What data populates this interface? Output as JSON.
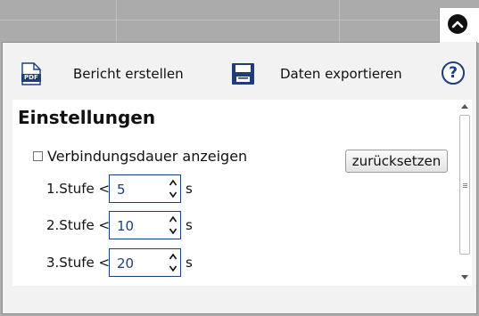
{
  "toolbar": {
    "report_label": "Bericht erstellen",
    "export_label": "Daten exportieren",
    "help_label": "?",
    "pdf_icon_text": "PDF"
  },
  "settings": {
    "title": "Einstellungen",
    "show_duration_label": "Verbindungsdauer anzeigen",
    "show_duration_checked": false,
    "reset_label": "zurücksetzen",
    "levels": [
      {
        "label": "1.Stufe <",
        "value": "5",
        "unit": "s"
      },
      {
        "label": "2.Stufe <",
        "value": "10",
        "unit": "s"
      },
      {
        "label": "3.Stufe <",
        "value": "20",
        "unit": "s"
      }
    ]
  },
  "colors": {
    "accent": "#1f3d7a",
    "panel_bg": "#f2f2f2",
    "page_bg": "#ababab"
  }
}
